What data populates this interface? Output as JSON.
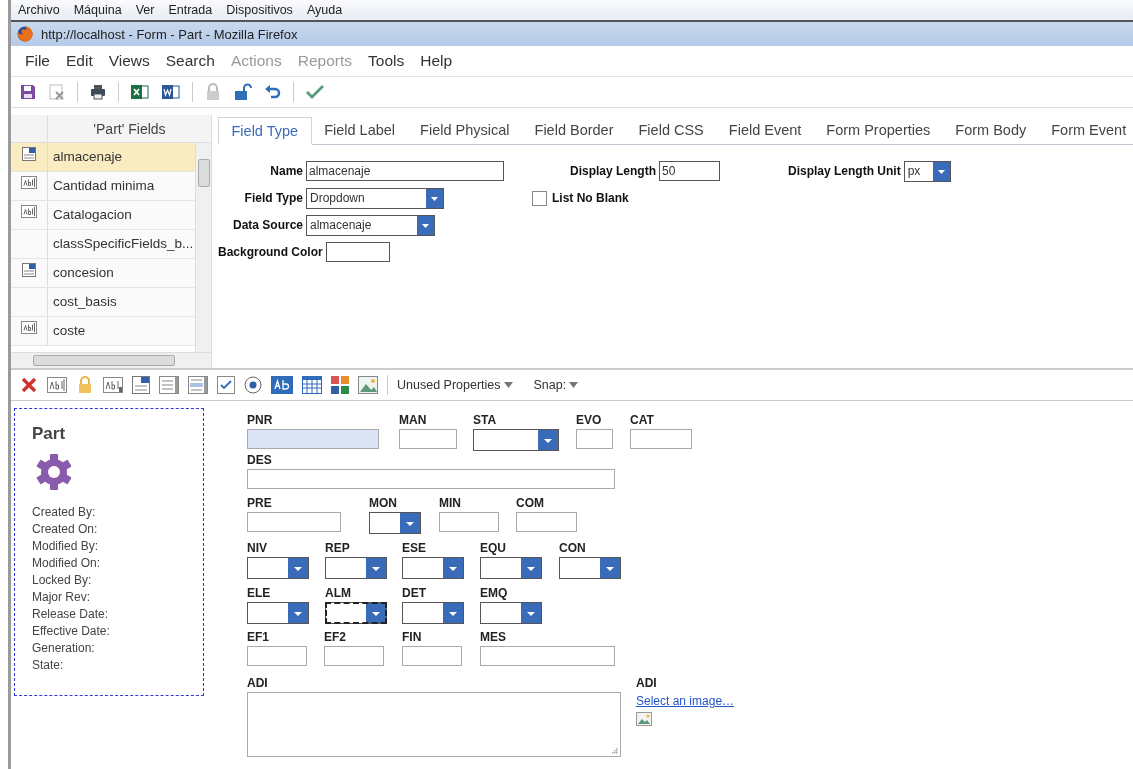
{
  "vm_menu": [
    "Archivo",
    "Máquina",
    "Ver",
    "Entrada",
    "Dispositivos",
    "Ayuda"
  ],
  "window": {
    "title": "http://localhost - Form - Part - Mozilla Firefox"
  },
  "menu": [
    {
      "label": "File",
      "disabled": false
    },
    {
      "label": "Edit",
      "disabled": false
    },
    {
      "label": "Views",
      "disabled": false
    },
    {
      "label": "Search",
      "disabled": false
    },
    {
      "label": "Actions",
      "disabled": true
    },
    {
      "label": "Reports",
      "disabled": true
    },
    {
      "label": "Tools",
      "disabled": false
    },
    {
      "label": "Help",
      "disabled": false
    }
  ],
  "fields_list": {
    "header": "'Part' Fields",
    "rows": [
      {
        "kind": "dropdown",
        "name": "almacenaje",
        "selected": true
      },
      {
        "kind": "text",
        "name": "Cantidad minima",
        "selected": false
      },
      {
        "kind": "text",
        "name": "Catalogacion",
        "selected": false
      },
      {
        "kind": "none",
        "name": "classSpecificFields_b...",
        "selected": false
      },
      {
        "kind": "dropdown",
        "name": "concesion",
        "selected": false
      },
      {
        "kind": "none",
        "name": "cost_basis",
        "selected": false
      },
      {
        "kind": "text",
        "name": "coste",
        "selected": false
      }
    ]
  },
  "tabs": [
    {
      "label": "Field Type",
      "selected": true
    },
    {
      "label": "Field Label",
      "selected": false
    },
    {
      "label": "Field Physical",
      "selected": false
    },
    {
      "label": "Field Border",
      "selected": false
    },
    {
      "label": "Field CSS",
      "selected": false
    },
    {
      "label": "Field Event",
      "selected": false
    },
    {
      "label": "Form Properties",
      "selected": false
    },
    {
      "label": "Form Body",
      "selected": false
    },
    {
      "label": "Form Event",
      "selected": false
    }
  ],
  "properties": {
    "name_label": "Name",
    "name_value": "almacenaje",
    "display_length_label": "Display Length",
    "display_length_value": "50",
    "unit_label": "Display Length Unit",
    "unit_value": "px",
    "field_type_label": "Field Type",
    "field_type_value": "Dropdown",
    "list_no_blank": {
      "label": "List No Blank",
      "checked": false
    },
    "data_source_label": "Data Source",
    "data_source_value": "almacenaje",
    "background_color_label": "Background Color"
  },
  "designer_toolbar": {
    "unused_properties": "Unused Properties",
    "snap": "Snap:"
  },
  "part_card": {
    "title": "Part",
    "info": [
      "Created By:",
      "Created On:",
      "Modified By:",
      "Modified On:",
      "Locked By:",
      "Major Rev:",
      "Release Date:",
      "Effective Date:",
      "Generation:",
      "State:"
    ]
  },
  "canvas": {
    "rows": [
      {
        "fields": [
          {
            "label": "PNR",
            "kind": "text",
            "highlighted": true,
            "selected": false
          },
          {
            "label": "MAN",
            "kind": "text",
            "highlighted": false,
            "selected": false
          },
          {
            "label": "STA",
            "kind": "dropdown",
            "highlighted": false,
            "selected": false
          },
          {
            "label": "EVO",
            "kind": "text",
            "highlighted": false,
            "selected": false
          },
          {
            "label": "CAT",
            "kind": "text",
            "highlighted": false,
            "selected": false
          }
        ]
      },
      {
        "fields": [
          {
            "label": "DES",
            "kind": "text",
            "highlighted": false,
            "selected": false
          }
        ]
      },
      {
        "fields": [
          {
            "label": "PRE",
            "kind": "text",
            "highlighted": false,
            "selected": false
          },
          {
            "label": "MON",
            "kind": "dropdown",
            "highlighted": false,
            "selected": false
          },
          {
            "label": "MIN",
            "kind": "text",
            "highlighted": false,
            "selected": false
          },
          {
            "label": "COM",
            "kind": "text",
            "highlighted": false,
            "selected": false
          }
        ]
      },
      {
        "fields": [
          {
            "label": "NIV",
            "kind": "dropdown",
            "highlighted": false,
            "selected": false
          },
          {
            "label": "REP",
            "kind": "dropdown",
            "highlighted": false,
            "selected": false
          },
          {
            "label": "ESE",
            "kind": "dropdown",
            "highlighted": false,
            "selected": false
          },
          {
            "label": "EQU",
            "kind": "dropdown",
            "highlighted": false,
            "selected": false
          },
          {
            "label": "CON",
            "kind": "dropdown",
            "highlighted": false,
            "selected": false
          }
        ]
      },
      {
        "fields": [
          {
            "label": "ELE",
            "kind": "dropdown",
            "highlighted": false,
            "selected": false
          },
          {
            "label": "ALM",
            "kind": "dropdown",
            "highlighted": false,
            "selected": true
          },
          {
            "label": "DET",
            "kind": "dropdown",
            "highlighted": false,
            "selected": false
          },
          {
            "label": "EMQ",
            "kind": "dropdown",
            "highlighted": false,
            "selected": false
          }
        ]
      },
      {
        "fields": [
          {
            "label": "EF1",
            "kind": "text",
            "highlighted": false,
            "selected": false
          },
          {
            "label": "EF2",
            "kind": "text",
            "highlighted": false,
            "selected": false
          },
          {
            "label": "FIN",
            "kind": "text",
            "highlighted": false,
            "selected": false
          },
          {
            "label": "MES",
            "kind": "text",
            "highlighted": false,
            "selected": false
          }
        ]
      },
      {
        "fields": [
          {
            "label": "ADI",
            "kind": "textarea",
            "highlighted": false,
            "selected": false
          },
          {
            "label": "ADI",
            "kind": "image",
            "link": "Select an image…",
            "highlighted": false,
            "selected": false
          }
        ]
      }
    ]
  }
}
